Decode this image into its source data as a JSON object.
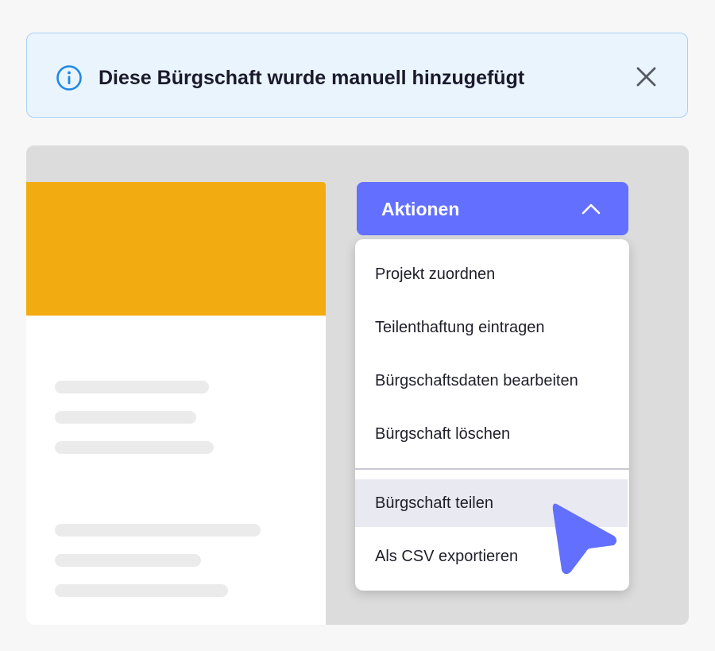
{
  "banner": {
    "message": "Diese Bürgschaft wurde manuell hinzugefügt",
    "info_icon": "info-circle-icon",
    "close_icon": "close-icon"
  },
  "actions": {
    "label": "Aktionen",
    "chevron_icon": "chevron-up-icon",
    "menu_items": [
      {
        "label": "Projekt zuordnen"
      },
      {
        "label": "Teilenthaftung eintragen"
      },
      {
        "label": "Bürgschaftsdaten bearbeiten"
      },
      {
        "label": "Bürgschaft löschen"
      },
      {
        "label": "Bürgschaft teilen",
        "hovered": true
      },
      {
        "label": "Als CSV exportieren"
      }
    ]
  },
  "colors": {
    "accent": "#6370FF",
    "card_header": "#F2AC11",
    "banner_bg": "#EAF4FD",
    "banner_border": "#A9D1F4",
    "info_blue": "#1E88E5",
    "panel_bg": "#DCDCDC",
    "hover_bg": "#E9E9F2"
  },
  "cursor_icon": "pointer-arrow-icon"
}
